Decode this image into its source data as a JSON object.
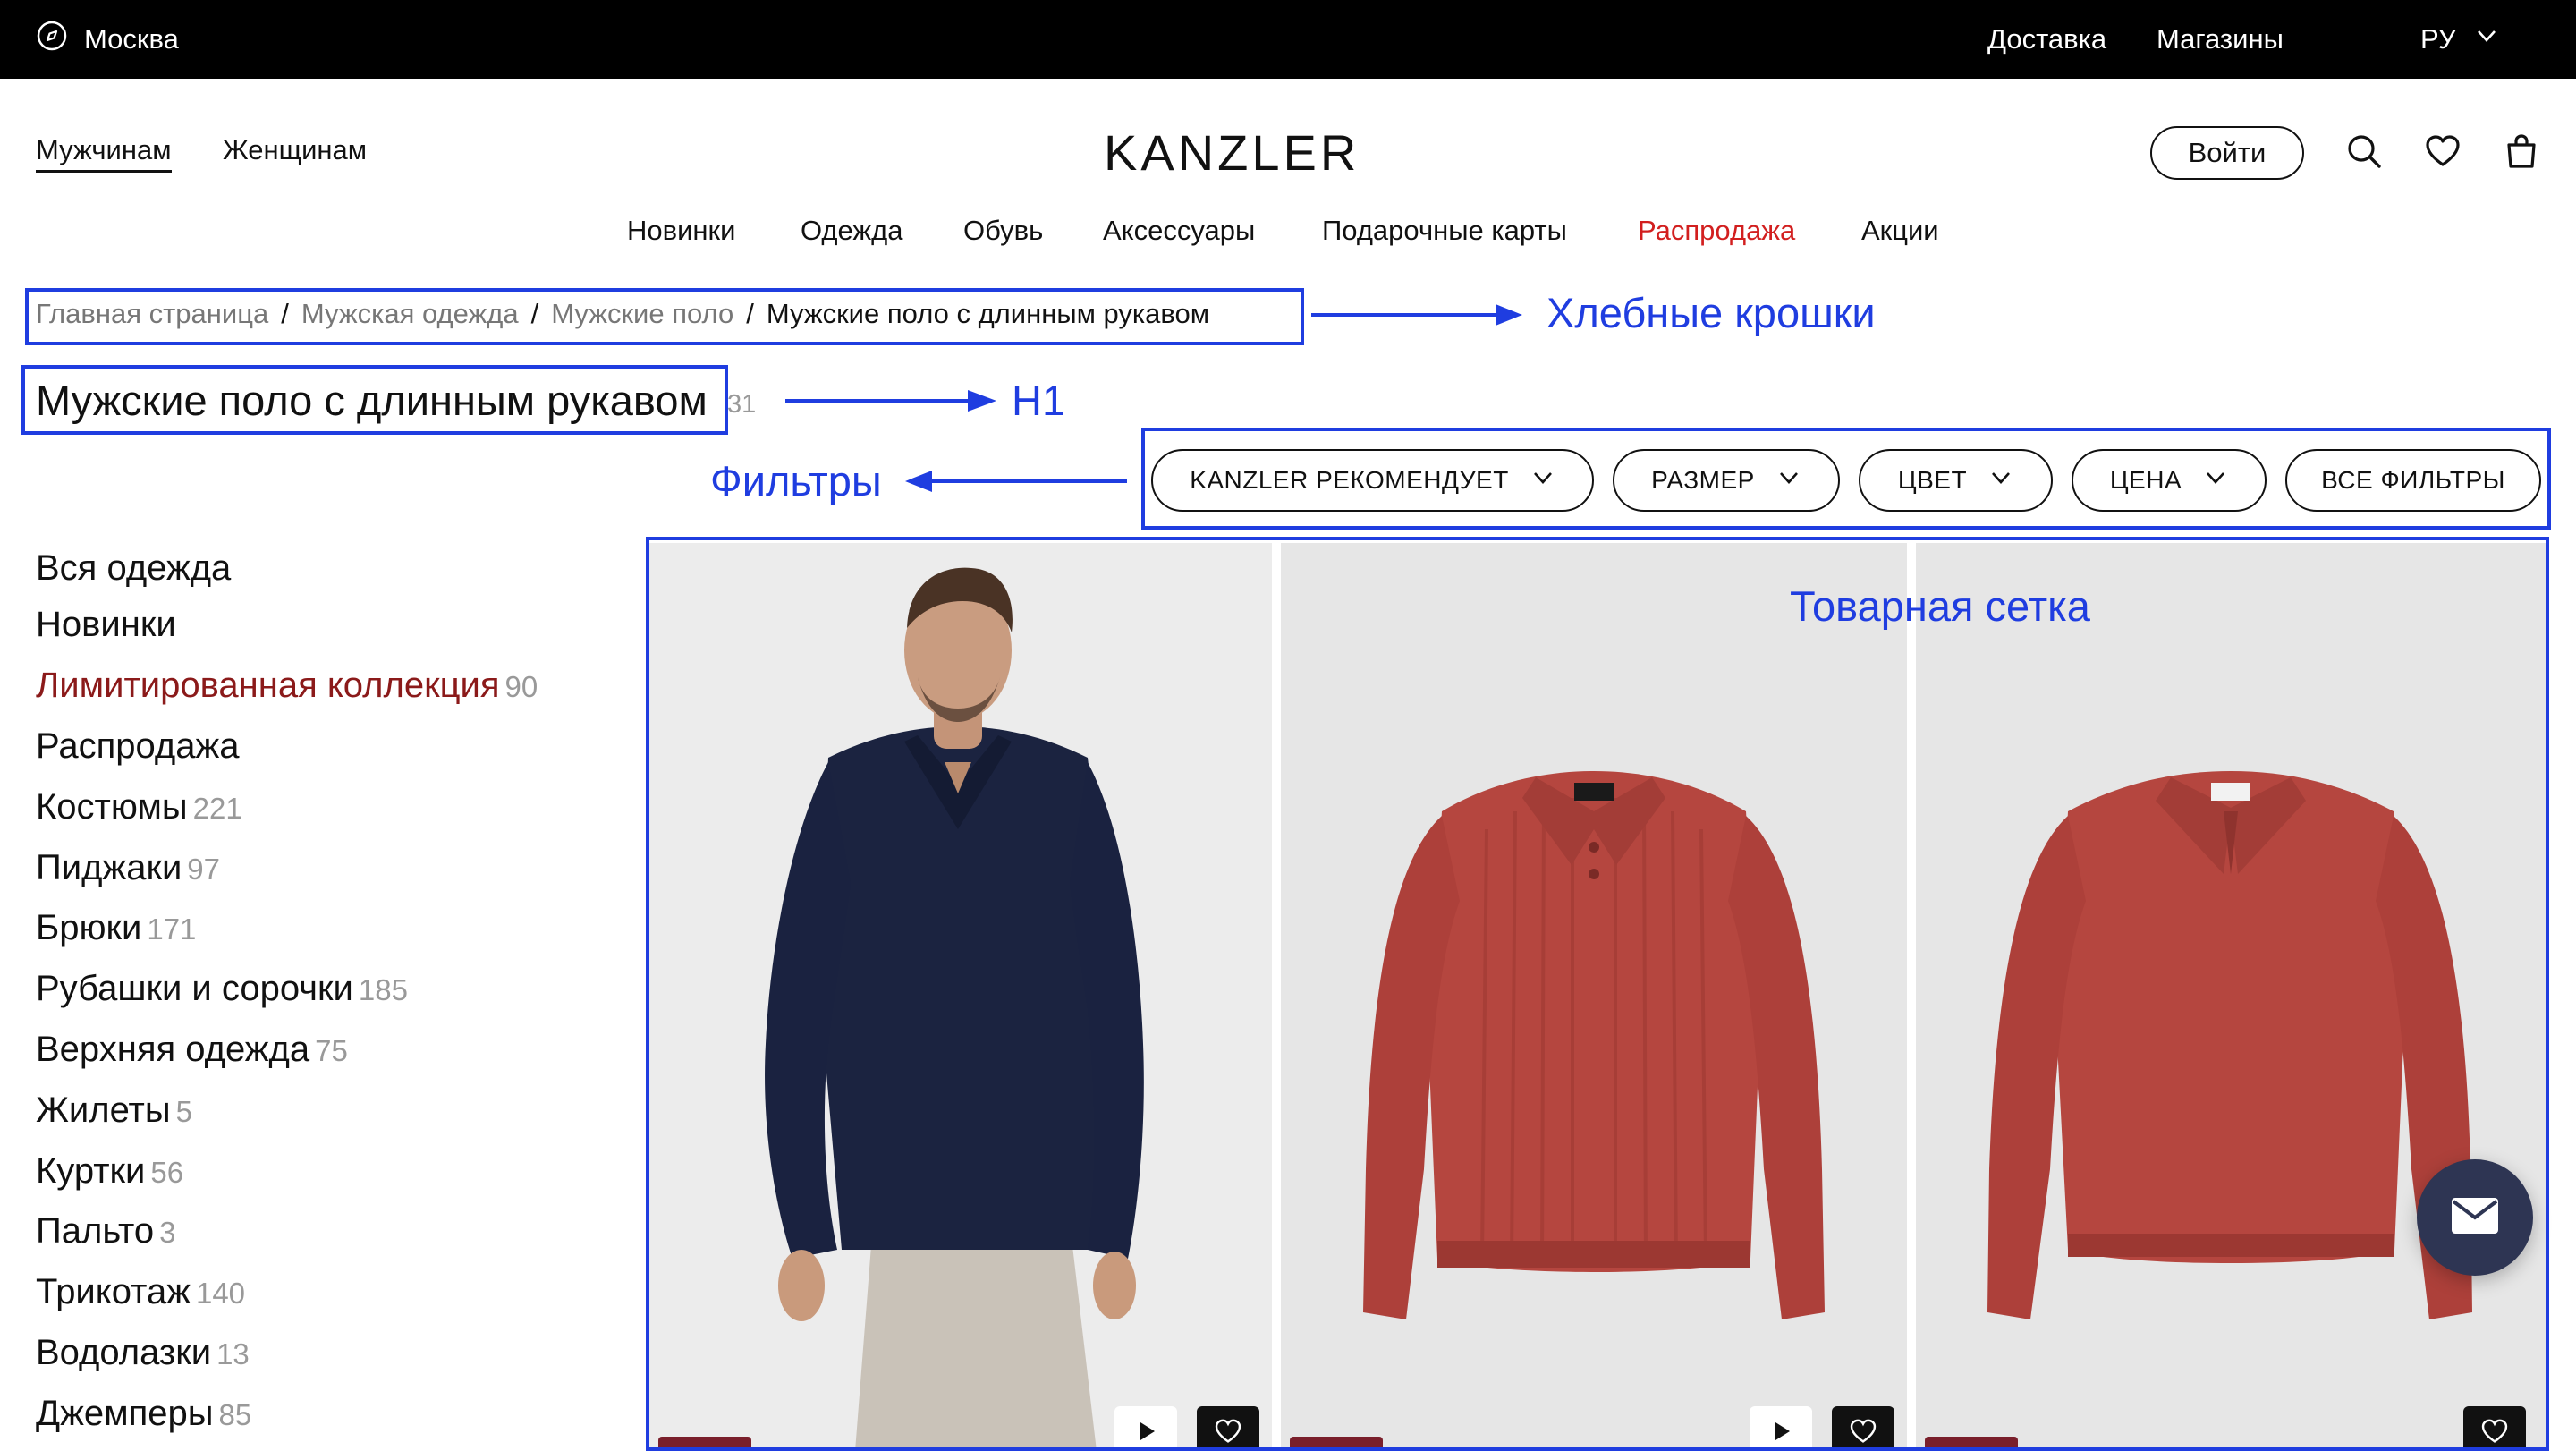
{
  "topbar": {
    "city": "Москва",
    "delivery": "Доставка",
    "stores": "Магазины",
    "lang": "РУ"
  },
  "header": {
    "gender_men": "Мужчинам",
    "gender_women": "Женщинам",
    "logo": "KANZLER",
    "login": "Войти"
  },
  "nav": [
    "Новинки",
    "Одежда",
    "Обувь",
    "Аксессуары",
    "Подарочные карты",
    "Распродажа",
    "Акции"
  ],
  "breadcrumbs": {
    "items": [
      "Главная страница",
      "Мужская одежда",
      "Мужские поло",
      "Мужские поло с длинным рукавом"
    ],
    "sep": "/"
  },
  "page": {
    "title": "Мужские поло с длинным рукавом",
    "count": "31"
  },
  "filters": [
    "KANZLER РЕКОМЕНДУЕТ",
    "РАЗМЕР",
    "ЦВЕТ",
    "ЦЕНА",
    "ВСЕ ФИЛЬТРЫ"
  ],
  "categories": [
    {
      "name": "Вся одежда",
      "count": ""
    },
    {
      "name": "Новинки",
      "count": ""
    },
    {
      "name": "Лимитированная коллекция",
      "count": "90"
    },
    {
      "name": "Распродажа",
      "count": ""
    },
    {
      "name": "Костюмы",
      "count": "221"
    },
    {
      "name": "Пиджаки",
      "count": "97"
    },
    {
      "name": "Брюки",
      "count": "171"
    },
    {
      "name": "Рубашки и сорочки",
      "count": "185"
    },
    {
      "name": "Верхняя одежда",
      "count": "75"
    },
    {
      "name": "Жилеты",
      "count": "5"
    },
    {
      "name": "Куртки",
      "count": "56"
    },
    {
      "name": "Пальто",
      "count": "3"
    },
    {
      "name": "Трикотаж",
      "count": "140"
    },
    {
      "name": "Водолазки",
      "count": "13"
    },
    {
      "name": "Джемперы",
      "count": "85"
    }
  ],
  "annotations": {
    "breadcrumbs": "Хлебные крошки",
    "h1": "H1",
    "filters": "Фильтры",
    "grid": "Товарная сетка"
  },
  "colors": {
    "annotation": "#1f3de0",
    "sale": "#d21f1f",
    "limited": "#8b1a1a",
    "navy_polo": "#1b2340",
    "red_polo": "#b5463f",
    "chat_button": "#2e3553"
  },
  "icons": [
    "compass-icon",
    "chevron-down-icon",
    "search-icon",
    "heart-icon",
    "bag-icon",
    "play-icon",
    "mail-icon"
  ]
}
